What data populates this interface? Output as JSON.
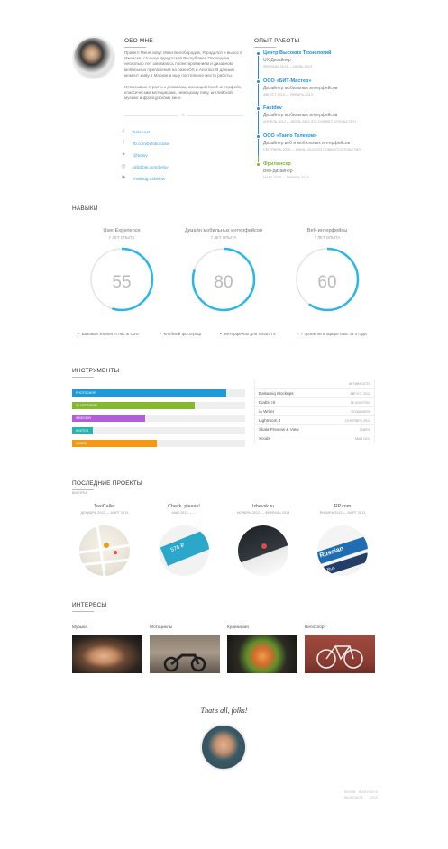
{
  "about": {
    "heading": "ОБО МНЕ",
    "para1": "Привет! Меня зовут Иван Белобородов. Я родился и вырос в Ижевске, столице Удмуртской Республики. Последние несколько лет занимаюсь проектированием и дизайном мобильных приложений на базе iOS и Android. В данный момент живу в Москве и ищу постоянное место работы.",
    "para2": "Испытываю страсть к девайсам, имеющим touch интерфейс, классическим мотоциклам, немецкому пиву, английской музыке и французскому кино.",
    "contacts": [
      {
        "icon": "person-icon",
        "glyph": "♙",
        "text": "belov.net"
      },
      {
        "icon": "facebook-icon",
        "glyph": "f",
        "text": "fb.com/beloborodov"
      },
      {
        "icon": "twitter-icon",
        "glyph": "✦",
        "text": "@belov"
      },
      {
        "icon": "dribbble-icon",
        "glyph": "◎",
        "text": "dribbble.com/belov"
      },
      {
        "icon": "flag-icon",
        "glyph": "⚑",
        "text": "moikrug.ru/belov/"
      }
    ]
  },
  "experience": {
    "heading": "ОПЫТ РАБОТЫ",
    "jobs": [
      {
        "company": "Центр Высоких Технологий",
        "role": "UX Дизайнер",
        "date": "ФЕВРАЛЬ 2013 — ИЮЛЬ 2013"
      },
      {
        "company": "ООО «БИТ-Мастер»",
        "role": "Дизайнер мобильных интерфейсов",
        "date": "АВГУСТ 2012 — ЯНВАРЬ 2013"
      },
      {
        "company": "Fastdev",
        "role": "Дизайнер мобильных интерфейсов",
        "date": "АПРЕЛЬ 2012 — ИЮЛЬ 2012 (ПО СОВМЕСТИТЕЛЬСТВУ)"
      },
      {
        "company": "ООО «Танго Телеком»",
        "role": "Дизайнер веб и мобильных интерфейсов",
        "date": "СЕНТЯБРЬ 2009 — ИЮНЬ 2012 (ПО СОВМЕСТИТЕЛЬСТВУ)"
      },
      {
        "company": "Фрилансер",
        "role": "Веб-дизайнер",
        "date": "МАРТ 2008 — ЯНВАРЬ 2013"
      }
    ],
    "accent_blue": "#1c8fd6",
    "accent_green": "#7cb82f"
  },
  "skills": {
    "heading": "НАВЫКИ",
    "items": [
      {
        "title": "User Experience",
        "years": "7 ЛЕТ ОПЫТА",
        "percent": 55,
        "value": "55"
      },
      {
        "title": "Дизайн мобильных интерфейсов",
        "years": "7 ЛЕТ ОПЫТА",
        "percent": 80,
        "value": "80"
      },
      {
        "title": "Веб-интерфейсы",
        "years": "7 ЛЕТ ОПЫТА",
        "percent": 60,
        "value": "60"
      }
    ],
    "bullets": [
      "Базовые знания HTML & CSS",
      "Клубный фотограф",
      "Интерфейсы для Smart TV",
      "7 проектов в офере пакс за 3 года"
    ],
    "ring_color": "#29b6e8"
  },
  "tools": {
    "heading": "ИНСТРУМЕНТЫ",
    "bars": [
      {
        "label": "PHOTOSHOP",
        "fraction": 0.89,
        "color": "#1e9ad6"
      },
      {
        "label": "ILLUSTRATOR",
        "fraction": 0.71,
        "color": "#85b92d"
      },
      {
        "label": "INDESIGN",
        "fraction": 0.42,
        "color": "#b05fd6"
      },
      {
        "label": "SKETCH",
        "fraction": 0.12,
        "color": "#28b3b0"
      },
      {
        "label": "AXURE",
        "fraction": 0.49,
        "color": "#f29b12"
      }
    ],
    "table_header": "АКТИВНОСТЬ",
    "rows": [
      {
        "name": "Balsamiq Mockups",
        "date": "АВГУСТ 2013"
      },
      {
        "name": "Diablo III",
        "date": "26 ЗОЛОТАЯ"
      },
      {
        "name": "iA Writer",
        "date": "ПОЗАВЧЕРА"
      },
      {
        "name": "Lightroom 4",
        "date": "СЕНТЯБРЬ 2013"
      },
      {
        "name": "Skala Preview & View",
        "date": "ВЧЕРА"
      },
      {
        "name": "Xcode",
        "date": "МАЙ 2013"
      }
    ]
  },
  "projects": {
    "heading": "ПОСЛЕДНИЕ ПРОЕКТЫ",
    "sub": "ВЫБОРКА",
    "items": [
      {
        "name": "TaxiCaller",
        "date": "ДЕКАБРЬ 2012 — МАРТ 2013"
      },
      {
        "name": "Check, please!",
        "date": "МАЙ 2013 — ..."
      },
      {
        "name": "Izhevsk.ru",
        "date": "НОЯБРЬ 2012 — ФЕВРАЛЬ 2013"
      },
      {
        "name": "RP.com",
        "date": "ЯНВАРЬ 2013 — МАРТ 2013"
      }
    ],
    "card_text_1": "578 ₽",
    "card_text_2": "Russian",
    "card_text_3": "Rus"
  },
  "interests": {
    "heading": "ИНТЕРЕСЫ",
    "items": [
      {
        "label": "Музыка"
      },
      {
        "label": "Мотоциклы"
      },
      {
        "label": "Кулинария"
      },
      {
        "label": "Велоспорт"
      }
    ]
  },
  "footer": {
    "quote": "That's all, folks!",
    "col1": [
      "БЕЛОВ",
      "ВКОНТАКТЕ"
    ],
    "col2": [
      "ВКОНТАКТЕ",
      "2013"
    ]
  }
}
